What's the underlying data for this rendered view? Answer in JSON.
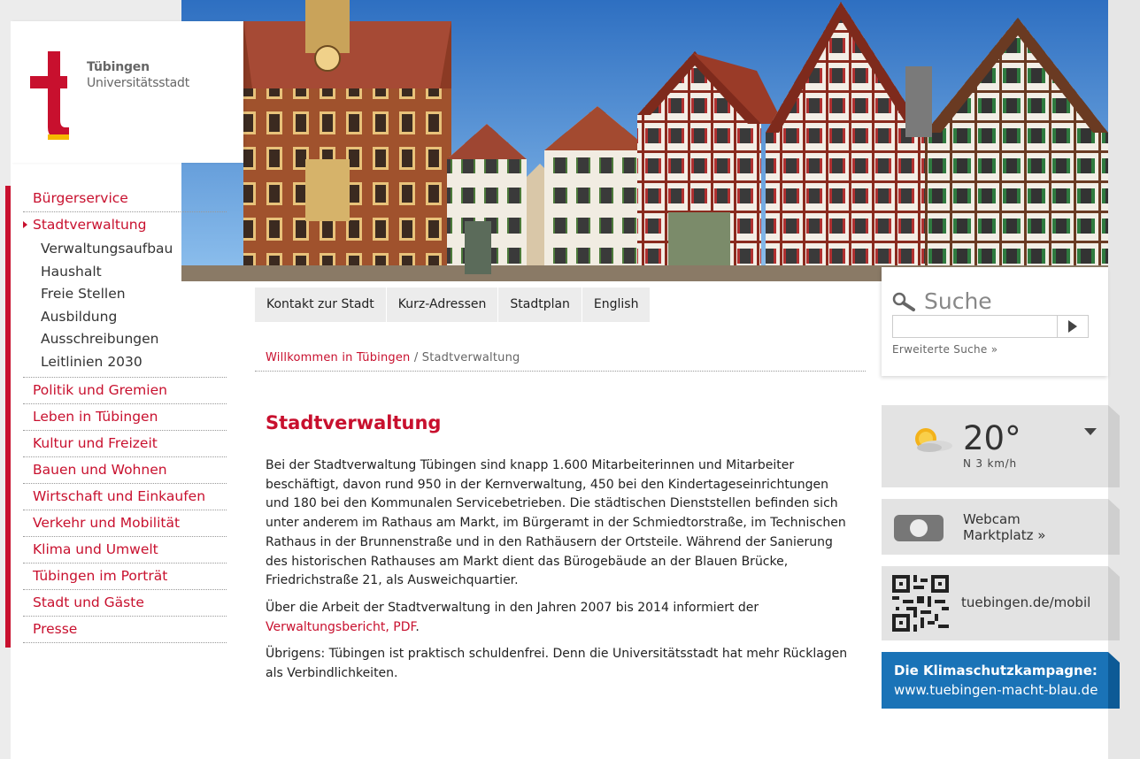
{
  "logo": {
    "line1": "Tübingen",
    "line2": "Universitätsstadt"
  },
  "nav": {
    "items_top": [
      {
        "label": "Bürgerservice"
      }
    ],
    "active": {
      "label": "Stadtverwaltung"
    },
    "subitems": [
      {
        "label": "Verwaltungsaufbau"
      },
      {
        "label": "Haushalt"
      },
      {
        "label": "Freie Stellen"
      },
      {
        "label": "Ausbildung"
      },
      {
        "label": "Ausschreibungen"
      },
      {
        "label": "Leitlinien 2030"
      }
    ],
    "items": [
      {
        "label": "Politik und Gremien"
      },
      {
        "label": "Leben in Tübingen"
      },
      {
        "label": "Kultur und Freizeit"
      },
      {
        "label": "Bauen und Wohnen"
      },
      {
        "label": "Wirtschaft und Einkaufen"
      },
      {
        "label": "Verkehr und Mobilität"
      },
      {
        "label": "Klima und Umwelt"
      },
      {
        "label": "Tübingen im Porträt"
      },
      {
        "label": "Stadt und Gäste"
      },
      {
        "label": "Presse"
      }
    ]
  },
  "tabs": [
    {
      "label": "Kontakt zur Stadt"
    },
    {
      "label": "Kurz-Adressen"
    },
    {
      "label": "Stadtplan"
    },
    {
      "label": "English"
    }
  ],
  "breadcrumb": {
    "link": "Willkommen in Tübingen",
    "separator": " / ",
    "current": "Stadtverwaltung"
  },
  "main": {
    "title": "Stadtverwaltung",
    "paragraph1": "Bei der Stadtverwaltung Tübingen sind knapp 1.600 Mitarbeiterinnen und Mitarbeiter beschäftigt, davon rund 950 in der Kernverwaltung, 450 bei den Kindertageseinrichtungen und 180 bei den Kommunalen Servicebetrieben. Die städtischen Dienststellen befinden sich unter anderem im Rathaus am Markt, im Bürgeramt in der Schmiedtorstraße, im Technischen Rathaus in der Brunnenstraße und in den Rathäusern der Ortsteile. Während der Sanierung des historischen Rathauses am Markt dient das Bürogebäude an der Blauen Brücke, Friedrichstraße 21, als Ausweichquartier.",
    "paragraph2_prefix": "Über die Arbeit der Stadtverwaltung in den Jahren 2007 bis 2014 informiert der ",
    "paragraph2_link": "Verwaltungsbericht, PDF",
    "paragraph2_suffix": ".",
    "paragraph3": "Übrigens: Tübingen ist praktisch schuldenfrei. Denn die Universitätsstadt hat mehr Rücklagen als Verbindlichkeiten."
  },
  "search": {
    "title": "Suche",
    "value": "",
    "placeholder": "",
    "advanced": "Erweiterte Suche »"
  },
  "weather": {
    "temperature": "20°",
    "wind": "N 3 km/h"
  },
  "webcam": {
    "line1": "Webcam",
    "line2": "Marktplatz »"
  },
  "mobile": {
    "link": "tuebingen.de/mobil"
  },
  "klima": {
    "line1": "Die Klimaschutzkampagne:",
    "line2": "www.tuebingen-macht-blau.de"
  },
  "colors": {
    "accent": "#c8102e",
    "logo_yellow": "#f5b800",
    "klima_blue": "#1a73b7",
    "widget_gray": "#e3e3e3"
  }
}
